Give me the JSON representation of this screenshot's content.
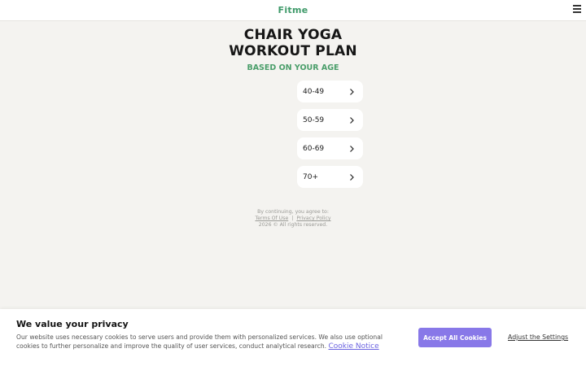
{
  "header": {
    "logo_text": "Fitme",
    "menu_icon": "hamburger-menu-icon"
  },
  "main": {
    "title_line1": "CHAIR YOGA",
    "title_line2": "WORKOUT PLAN",
    "subtitle": "BASED ON YOUR AGE",
    "age_options": [
      {
        "label": "40-49",
        "icon": "chevron-right-icon"
      },
      {
        "label": "50-59",
        "icon": "chevron-right-icon"
      },
      {
        "label": "60-69",
        "icon": "chevron-right-icon"
      },
      {
        "label": "70+",
        "icon": "chevron-right-icon"
      }
    ]
  },
  "legal": {
    "agree_text": "By continuing, you agree to:",
    "terms_label": "Terms Of Use",
    "separator": "|",
    "privacy_label": "Privacy Policy",
    "copyright": "2026 © All rights reserved."
  },
  "cookie_banner": {
    "title": "We value your privacy",
    "body": "Our website uses necessary cookies to serve users and provide them with personalized services. We also use optional cookies to further personalize and improve the quality of user services, conduct analytical research.",
    "cookie_notice_label": "Cookie Notice",
    "accept_label": "Accept All Cookies",
    "settings_label": "Adjust the Settings"
  },
  "colors": {
    "brand_green": "#3f9a6a",
    "accent_purple": "#8878e8",
    "background": "#f4f3f0"
  }
}
